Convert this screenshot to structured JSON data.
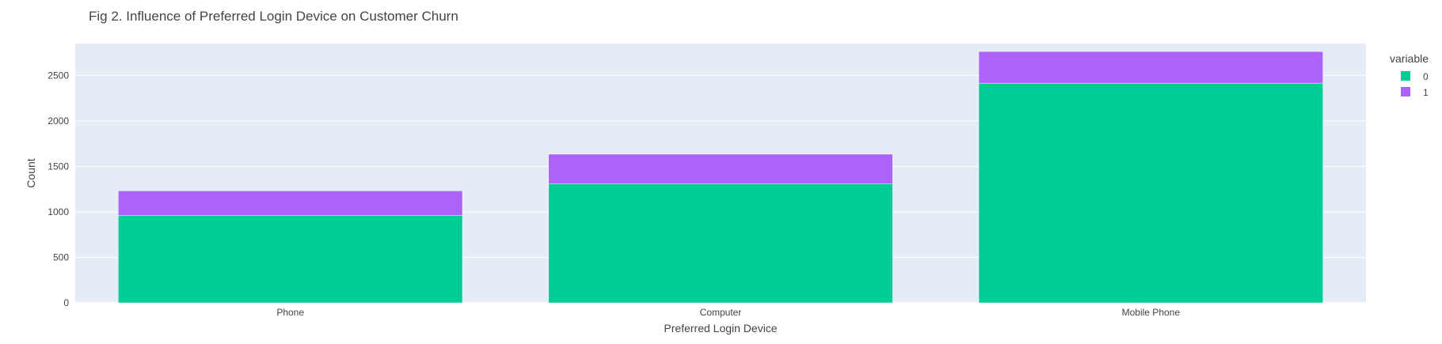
{
  "chart_data": {
    "type": "bar",
    "barmode": "stack",
    "title": "Fig 2. Influence of Preferred Login Device on Customer Churn",
    "xlabel": "Preferred Login Device",
    "ylabel": "Count",
    "categories": [
      "Phone",
      "Computer",
      "Mobile Phone"
    ],
    "series": [
      {
        "name": "0",
        "values": [
          958,
          1310,
          2414
        ],
        "color": "#00cc96"
      },
      {
        "name": "1",
        "values": [
          273,
          324,
          348
        ],
        "color": "#ab63fa"
      }
    ],
    "ylim": [
      0,
      2850
    ],
    "yticks": [
      0,
      500,
      1000,
      1500,
      2000,
      2500
    ],
    "legend": {
      "title": "variable",
      "position": "top-right"
    },
    "grid": true,
    "plot_background": "#e5ecf6",
    "gridline_color": "#ffffff"
  }
}
